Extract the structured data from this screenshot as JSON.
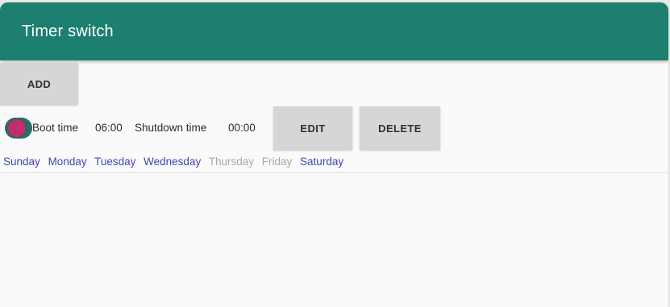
{
  "appbar": {
    "title": "Timer switch",
    "color": "#1d7f70"
  },
  "toolbar": {
    "add_label": "ADD"
  },
  "timer": {
    "enabled": true,
    "boot_label": "Boot time",
    "boot_value": "06:00",
    "shutdown_label": "Shutdown time",
    "shutdown_value": "00:00",
    "edit_label": "EDIT",
    "delete_label": "DELETE",
    "toggle_thumb_color": "#c22e6a",
    "active_day_color": "#3f47b5",
    "inactive_day_color": "#a8a8a8",
    "days": [
      {
        "label": "Sunday",
        "active": true
      },
      {
        "label": "Monday",
        "active": true
      },
      {
        "label": "Tuesday",
        "active": true
      },
      {
        "label": "Wednesday",
        "active": true
      },
      {
        "label": "Thursday",
        "active": false
      },
      {
        "label": "Friday",
        "active": false
      },
      {
        "label": "Saturday",
        "active": true
      }
    ]
  }
}
